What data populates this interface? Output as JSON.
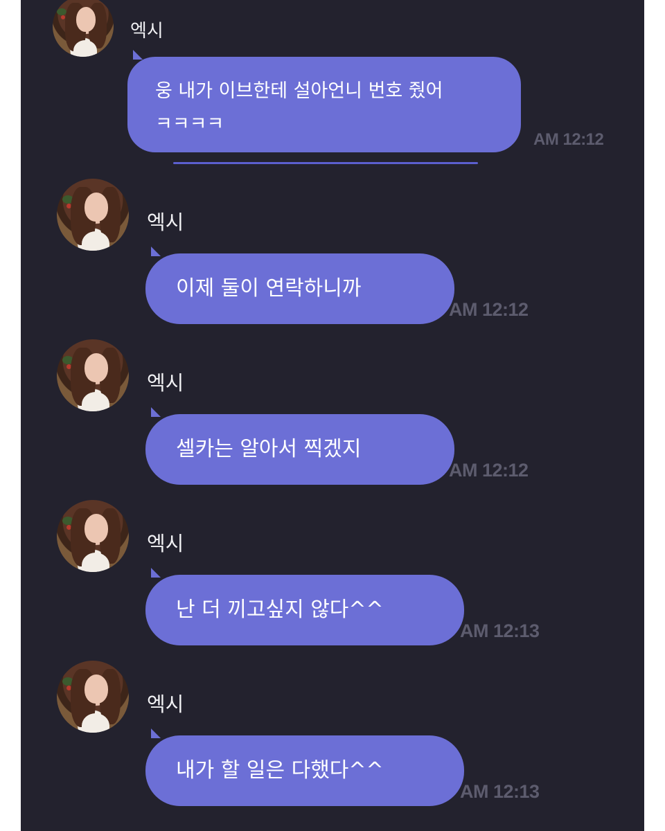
{
  "messages": [
    {
      "sender": "엑시",
      "text_lines": [
        "웅 내가 이브한테 설아언니 번호 줬어",
        "ㅋㅋㅋㅋ"
      ],
      "time": "AM 12:12"
    },
    {
      "sender": "엑시",
      "text_lines": [
        "이제 둘이 연락하니까"
      ],
      "time": "AM 12:12"
    },
    {
      "sender": "엑시",
      "text_lines": [
        "셀카는 알아서 찍겠지"
      ],
      "time": "AM 12:12"
    },
    {
      "sender": "엑시",
      "text_lines": [
        "난 더 끼고싶지 않다^^"
      ],
      "time": "AM 12:13"
    },
    {
      "sender": "엑시",
      "text_lines": [
        "내가 할 일은 다했다^^"
      ],
      "time": "AM 12:13"
    }
  ],
  "colors": {
    "background": "#23222e",
    "bubble": "#6c6fd6",
    "bubble_text": "#ffffff",
    "sender_text": "#f1f1f4",
    "time_text": "#5d5c6e"
  },
  "icons": {
    "avatar": "profile-photo"
  }
}
